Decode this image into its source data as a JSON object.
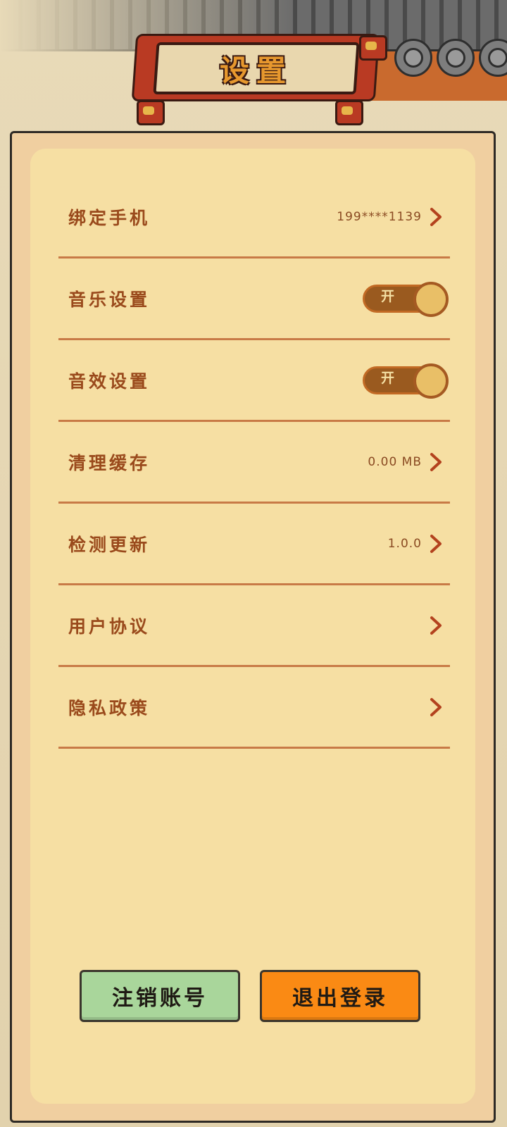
{
  "header": {
    "title": "设置"
  },
  "settings": {
    "rows": [
      {
        "label": "绑定手机",
        "value": "199****1139"
      },
      {
        "label": "音乐设置",
        "toggle": "开"
      },
      {
        "label": "音效设置",
        "toggle": "开"
      },
      {
        "label": "清理缓存",
        "value": "0.00 MB"
      },
      {
        "label": "检测更新",
        "value": "1.0.0"
      },
      {
        "label": "用户协议",
        "value": ""
      },
      {
        "label": "隐私政策",
        "value": ""
      }
    ]
  },
  "buttons": {
    "cancel_account": "注销账号",
    "logout": "退出登录"
  },
  "colors": {
    "panel": "#f6dfa3",
    "label": "#9a4a1c",
    "divider": "#c87a46",
    "cancel_button": "#a9d69b",
    "logout_button": "#fa8a14",
    "title_banner": "#b93a23"
  }
}
